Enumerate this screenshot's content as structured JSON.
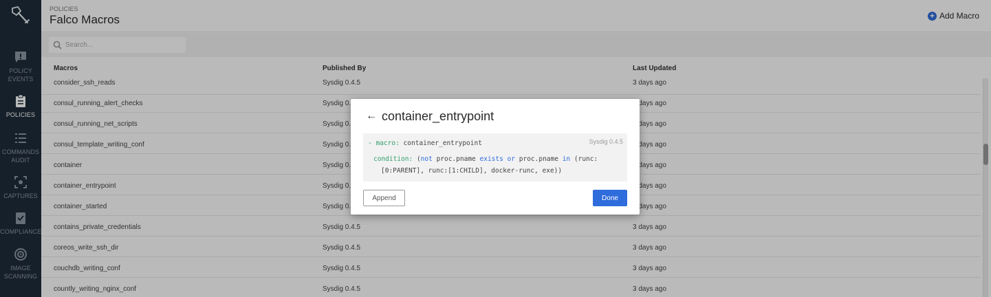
{
  "sidebar": {
    "logo": "shovel-logo",
    "items": [
      {
        "label_lines": [
          "POLICY",
          "EVENTS"
        ],
        "icon": "alert-bubble-icon",
        "active": false
      },
      {
        "label_lines": [
          "POLICIES"
        ],
        "icon": "clipboard-icon",
        "active": true
      },
      {
        "label_lines": [
          "COMMANDS",
          "AUDIT"
        ],
        "icon": "list-icon",
        "active": false
      },
      {
        "label_lines": [
          "CAPTURES"
        ],
        "icon": "capture-icon",
        "active": false
      },
      {
        "label_lines": [
          "COMPLIANCE"
        ],
        "icon": "checklist-icon",
        "active": false
      },
      {
        "label_lines": [
          "IMAGE",
          "SCANNING"
        ],
        "icon": "target-icon",
        "active": false
      }
    ]
  },
  "header": {
    "breadcrumb": "POLICIES",
    "title": "Falco Macros",
    "add_label": "Add Macro"
  },
  "search": {
    "placeholder": "Search..."
  },
  "table": {
    "columns": [
      "Macros",
      "Published By",
      "Last Updated"
    ],
    "rows": [
      {
        "macro": "consider_ssh_reads",
        "published": "Sysdig 0.4.5",
        "updated": "3 days ago"
      },
      {
        "macro": "consul_running_alert_checks",
        "published": "Sysdig 0.4.5",
        "updated": "3 days ago"
      },
      {
        "macro": "consul_running_net_scripts",
        "published": "Sysdig 0.4.5",
        "updated": "3 days ago"
      },
      {
        "macro": "consul_template_writing_conf",
        "published": "Sysdig 0.4.5",
        "updated": "3 days ago"
      },
      {
        "macro": "container",
        "published": "Sysdig 0.4.5",
        "updated": "3 days ago"
      },
      {
        "macro": "container_entrypoint",
        "published": "Sysdig 0.4.5",
        "updated": "3 days ago"
      },
      {
        "macro": "container_started",
        "published": "Sysdig 0.4.5",
        "updated": "3 days ago"
      },
      {
        "macro": "contains_private_credentials",
        "published": "Sysdig 0.4.5",
        "updated": "3 days ago"
      },
      {
        "macro": "coreos_write_ssh_dir",
        "published": "Sysdig 0.4.5",
        "updated": "3 days ago"
      },
      {
        "macro": "couchdb_writing_conf",
        "published": "Sysdig 0.4.5",
        "updated": "3 days ago"
      },
      {
        "macro": "countly_writing_nginx_conf",
        "published": "Sysdig 0.4.5",
        "updated": "3 days ago"
      }
    ]
  },
  "modal": {
    "title": "container_entrypoint",
    "version": "Sysdig 0.4.5",
    "code": {
      "dash": "-",
      "macro_key": "macro:",
      "macro_name": "container_entrypoint",
      "condition_key": "condition:",
      "open_paren": "(",
      "not_kw": "not",
      "field1": "proc.pname",
      "exists_kw": "exists",
      "or_kw": "or",
      "field2": "proc.pname",
      "in_kw": "in",
      "list_start": "(runc:",
      "line3": "[0:PARENT], runc:[1:CHILD], docker-runc, exe))"
    },
    "append_label": "Append",
    "done_label": "Done"
  },
  "colors": {
    "sidebar_bg": "#1f2d3a",
    "accent": "#2f6cdc",
    "code_keyword": "#2f9e6a"
  }
}
